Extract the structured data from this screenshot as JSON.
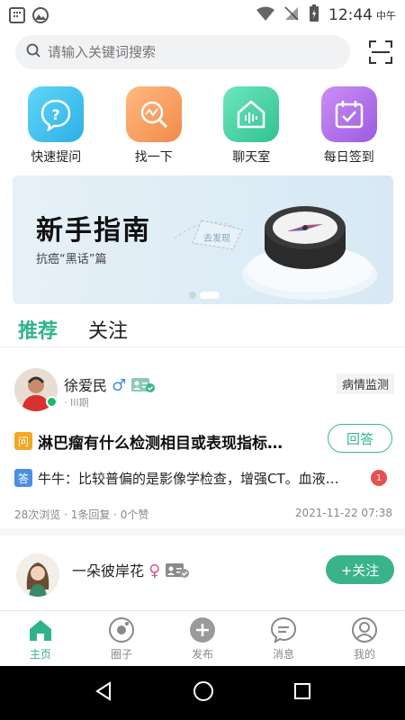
{
  "status_bar": {
    "time": "12:44",
    "ampm": "中午"
  },
  "search": {
    "placeholder": "请输入关键词搜索"
  },
  "quick_actions": [
    {
      "label": "快速提问",
      "icon": "question-icon",
      "color": "#3fc3ee"
    },
    {
      "label": "找一下",
      "icon": "search-chart-icon",
      "color": "#f6a05f"
    },
    {
      "label": "聊天室",
      "icon": "chat-room-icon",
      "color": "#4fd6a8"
    },
    {
      "label": "每日签到",
      "icon": "checkin-icon",
      "color": "#b574e8"
    }
  ],
  "banner": {
    "title": "新手指南",
    "subtitle": "抗癌“黑话”篇",
    "badge": "去发现"
  },
  "tabs": {
    "recommend": "推荐",
    "follow": "关注"
  },
  "post1": {
    "username": "徐爱民",
    "gender": "♂",
    "stage": "· III期",
    "tag": "病情监测",
    "question_badge": "问",
    "question": "淋巴瘤有什么检测相目或表现指标…",
    "answer_button": "回答",
    "answer_badge": "答",
    "answer": "牛牛：比较普偏的是影像学检查，增强CT。血液…",
    "unread_count": "1",
    "meta": "28次浏览 · 1条回复 · 0个赞",
    "date": "2021-11-22 07:38"
  },
  "post2": {
    "username": "一朵彼岸花",
    "gender": "♀",
    "follow_button": "+关注"
  },
  "bottom_nav": [
    {
      "label": "主页",
      "icon": "home-icon",
      "active": true
    },
    {
      "label": "圈子",
      "icon": "circle-icon",
      "active": false
    },
    {
      "label": "发布",
      "icon": "plus-icon",
      "active": false
    },
    {
      "label": "消息",
      "icon": "message-icon",
      "active": false
    },
    {
      "label": "我的",
      "icon": "profile-icon",
      "active": false
    }
  ],
  "colors": {
    "accent": "#2fb38a",
    "male": "#3b8ee9",
    "female": "#e0508a"
  }
}
